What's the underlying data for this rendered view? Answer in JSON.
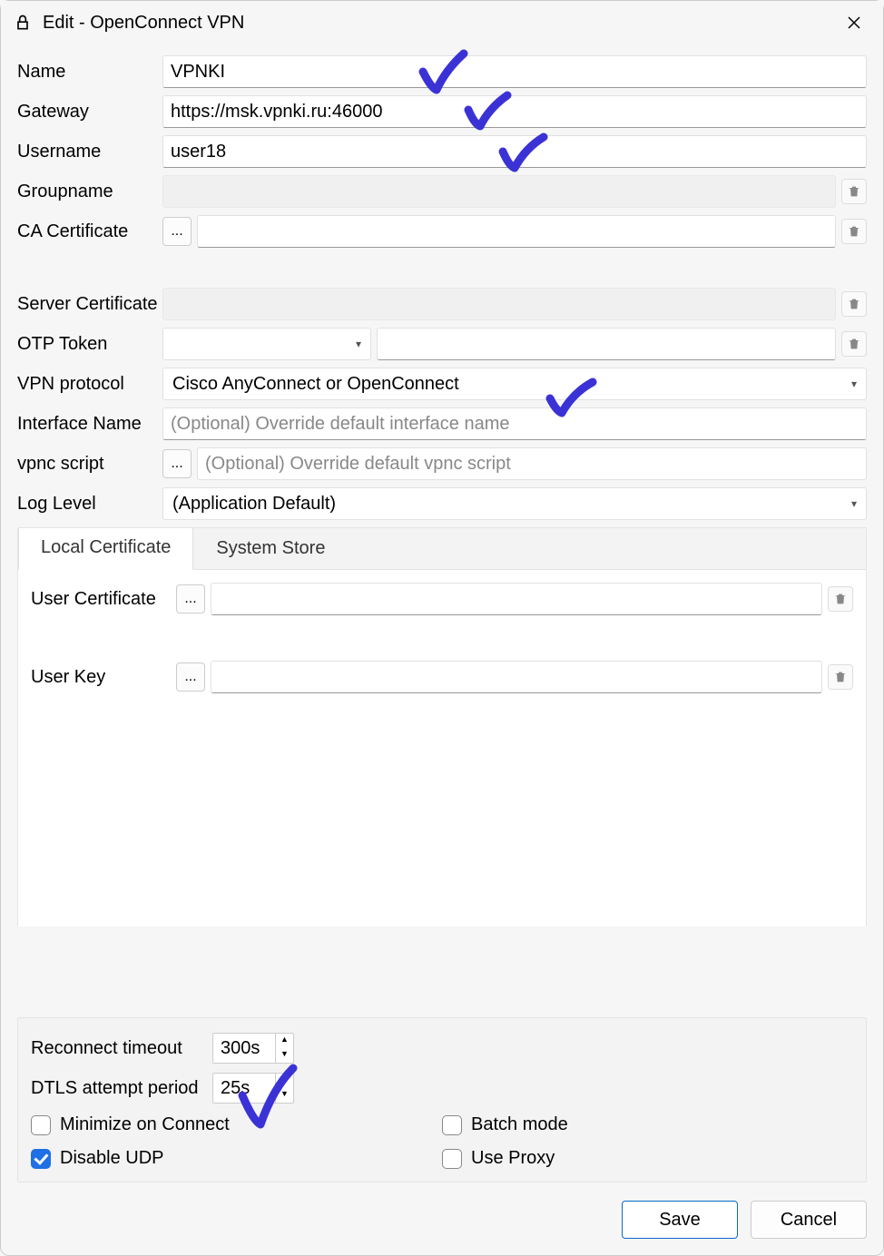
{
  "window": {
    "title": "Edit - OpenConnect VPN"
  },
  "fields": {
    "name": {
      "label": "Name",
      "value": "VPNKI"
    },
    "gateway": {
      "label": "Gateway",
      "value": "https://msk.vpnki.ru:46000"
    },
    "username": {
      "label": "Username",
      "value": "user18"
    },
    "groupname": {
      "label": "Groupname",
      "value": ""
    },
    "ca_cert": {
      "label": "CA Certificate",
      "value": ""
    },
    "server_cert": {
      "label": "Server Certificate",
      "value": ""
    },
    "otp_token": {
      "label": "OTP Token",
      "select": "",
      "text": ""
    },
    "vpn_proto": {
      "label": "VPN protocol",
      "value": "Cisco AnyConnect or OpenConnect"
    },
    "iface_name": {
      "label": "Interface Name",
      "placeholder": "(Optional) Override default interface name"
    },
    "vpnc_script": {
      "label": "vpnc script",
      "placeholder": "(Optional) Override default vpnc script"
    },
    "log_level": {
      "label": "Log Level",
      "value": "(Application Default)"
    }
  },
  "tabs": {
    "local_cert": {
      "label": "Local Certificate",
      "active": true
    },
    "system_store": {
      "label": "System Store",
      "active": false
    },
    "user_cert": {
      "label": "User Certificate",
      "value": ""
    },
    "user_key": {
      "label": "User Key",
      "value": ""
    }
  },
  "bottom": {
    "reconnect": {
      "label": "Reconnect timeout",
      "value": "300s"
    },
    "dtls": {
      "label": "DTLS attempt period",
      "value": "25s"
    },
    "min_on_connect": {
      "label": "Minimize on Connect",
      "checked": false
    },
    "batch_mode": {
      "label": "Batch mode",
      "checked": false
    },
    "disable_udp": {
      "label": "Disable UDP",
      "checked": true
    },
    "use_proxy": {
      "label": "Use Proxy",
      "checked": false
    }
  },
  "buttons": {
    "save": "Save",
    "cancel": "Cancel"
  },
  "browse_label": "..."
}
